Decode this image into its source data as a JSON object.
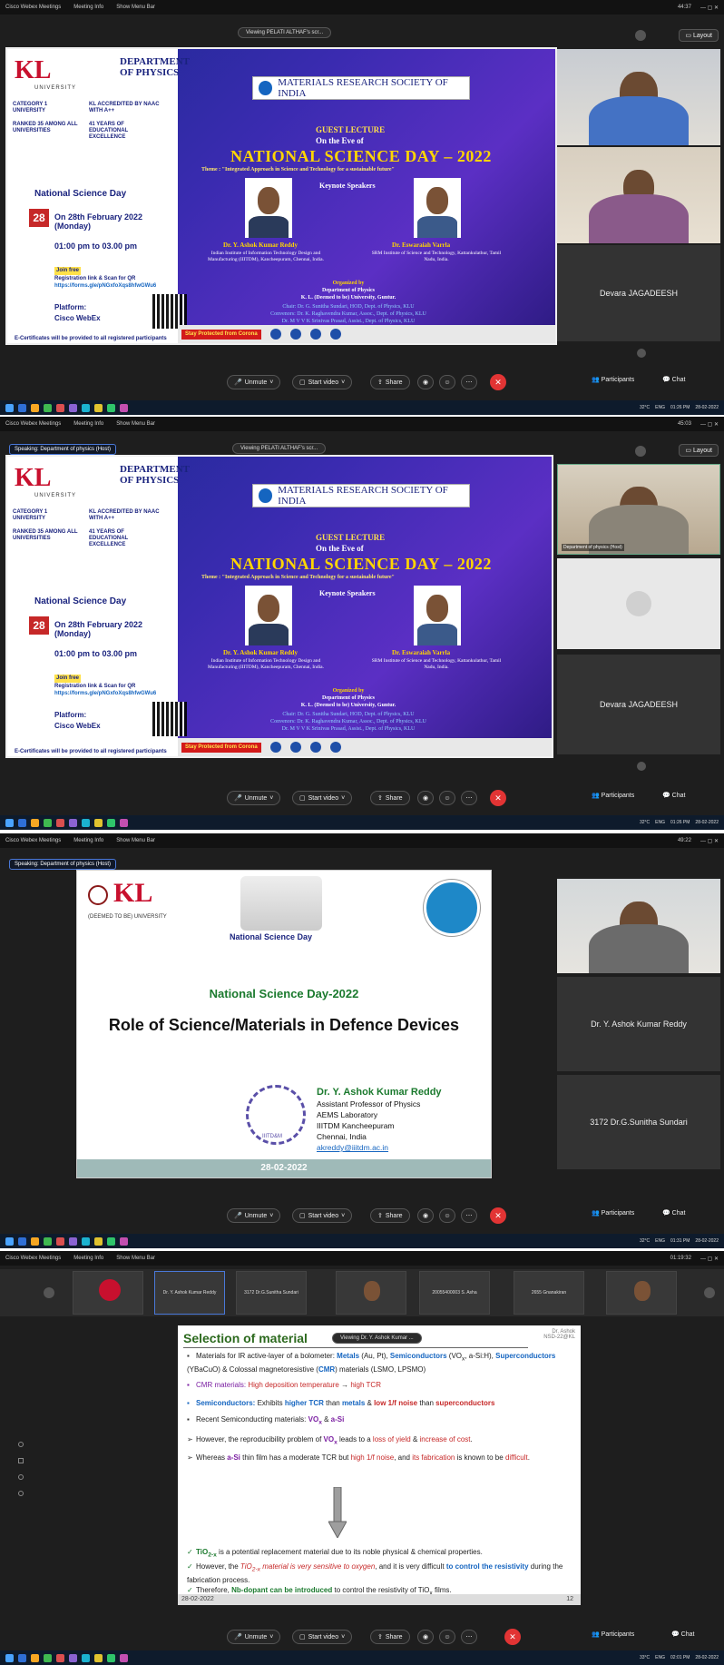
{
  "app": {
    "name": "Cisco Webex Meetings",
    "meeting_info": "Meeting Info",
    "show_menu_bar": "Show Menu Bar",
    "layout": "Layout"
  },
  "controls": {
    "unmute": "Unmute",
    "start_video": "Start video",
    "share": "Share",
    "participants": "Participants",
    "chat": "Chat"
  },
  "shots": [
    {
      "timer": "44:37",
      "viewing": "Viewing PELATI ALTHAF's scr...",
      "tile_name": "Devara JAGADEESH",
      "tray_temp": "32°C",
      "tray_lang": "ENG",
      "tray_time": "01:26 PM",
      "tray_date": "28-02-2022"
    },
    {
      "timer": "45:03",
      "viewing": "Viewing PELATI ALTHAF's scr...",
      "speaking": "Speaking: Department of physics (Host)",
      "tile_label": "Department of physics (Host)",
      "tile_name": "Devara JAGADEESH",
      "tray_temp": "32°C",
      "tray_lang": "ENG",
      "tray_time": "01:26 PM",
      "tray_date": "28-02-2022"
    },
    {
      "timer": "49:22",
      "speaking": "Speaking: Department of physics (Host)",
      "tile1": "Dr. Y. Ashok Kumar Reddy",
      "tile2": "3172 Dr.G.Sunitha Sundari",
      "tray_temp": "32°C",
      "tray_lang": "ENG",
      "tray_time": "01:31 PM",
      "tray_date": "28-02-2022"
    },
    {
      "timer": "01:19:32",
      "viewing": "Viewing Dr. Y. Ashok Kumar ...",
      "thumbs": [
        "Dr. Y. Ashok Kumar Reddy",
        "3172 Dr.G.Sunitha Sundari",
        "",
        "20055400003 S. Asha",
        "2655 Gnanakiran"
      ],
      "tray_temp": "33°C",
      "tray_lang": "ENG",
      "tray_time": "02:01 PM",
      "tray_date": "28-02-2022"
    }
  ],
  "poster": {
    "kl": "KL",
    "university": "UNIVERSITY",
    "dept": "DEPARTMENT OF PHYSICS",
    "category": "CATEGORY 1 UNIVERSITY",
    "naac": "KL ACCREDITED BY NAAC WITH A++",
    "nirf": "RANKED 35 AMONG ALL UNIVERSITIES",
    "years": "41 YEARS OF EDUCATIONAL EXCELLENCE",
    "nsd": "National Science Day",
    "date_badge": "28",
    "date": "On 28th February 2022 (Monday)",
    "time": "01:00 pm to 03.00 pm",
    "join": "Join free",
    "reg": "Registration link & Scan for QR",
    "link": "https://forms.gle/pNGxfoXqs8hfwGWu6",
    "platform_lbl": "Platform:",
    "platform": "Cisco WebEx",
    "ecert": "E-Certificates will be provided to all registered participants",
    "mrsi": "MATERIALS RESEARCH SOCIETY OF INDIA",
    "guest": "GUEST LECTURE",
    "eve": "On the Eve of",
    "title": "NATIONAL SCIENCE DAY – 2022",
    "theme": "Theme : \"Integrated Approach in Science and Technology for a sustainable future\"",
    "keynote": "Keynote Speakers",
    "s1_name": "Dr. Y. Ashok Kumar Reddy",
    "s1_inst": "Indian Institute of Information Technology Design and Manufacturing (IIITDM), Kancheepuram, Chennai, India.",
    "s2_name": "Dr. Eswaraiah Varrla",
    "s2_inst": "SRM Institute of Science and Technology, Kattankulathur, Tamil Nadu, India.",
    "org1": "Organized by",
    "org2": "Department of Physics",
    "org3": "K. L. (Deemed to be) University, Guntur.",
    "org4": "Chair: Dr. G. Sunitha Sundari, HOD, Dept. of Physics, KLU",
    "org5": "Convenors: Dr. K. Raghavendra Kumar, Assoc., Dept. of Physics, KLU",
    "org6": "Dr. M V V K Srinivas Prasad, Assist., Dept. of Physics, KLU",
    "stay": "Stay Protected from Corona"
  },
  "slide3": {
    "nsd": "National Science Day",
    "heading": "National Science Day-2022",
    "title": "Role of Science/Materials in Defence Devices",
    "name": "Dr. Y. Ashok Kumar Reddy",
    "role": "Assistant Professor of Physics",
    "lab": "AEMS Laboratory",
    "inst": "IIITDM Kancheepuram",
    "city": "Chennai, India",
    "email": "akreddy@iiitdm.ac.in",
    "date": "28-02-2022",
    "kl_sub": "(DEEMED TO BE) UNIVERSITY",
    "iiitdm": "IIITD&M"
  },
  "slide4": {
    "title": "Selection of material",
    "corner1": "Dr. Ashok",
    "corner2": "NSD-22@KL",
    "date": "28-02-2022",
    "page": "12"
  }
}
